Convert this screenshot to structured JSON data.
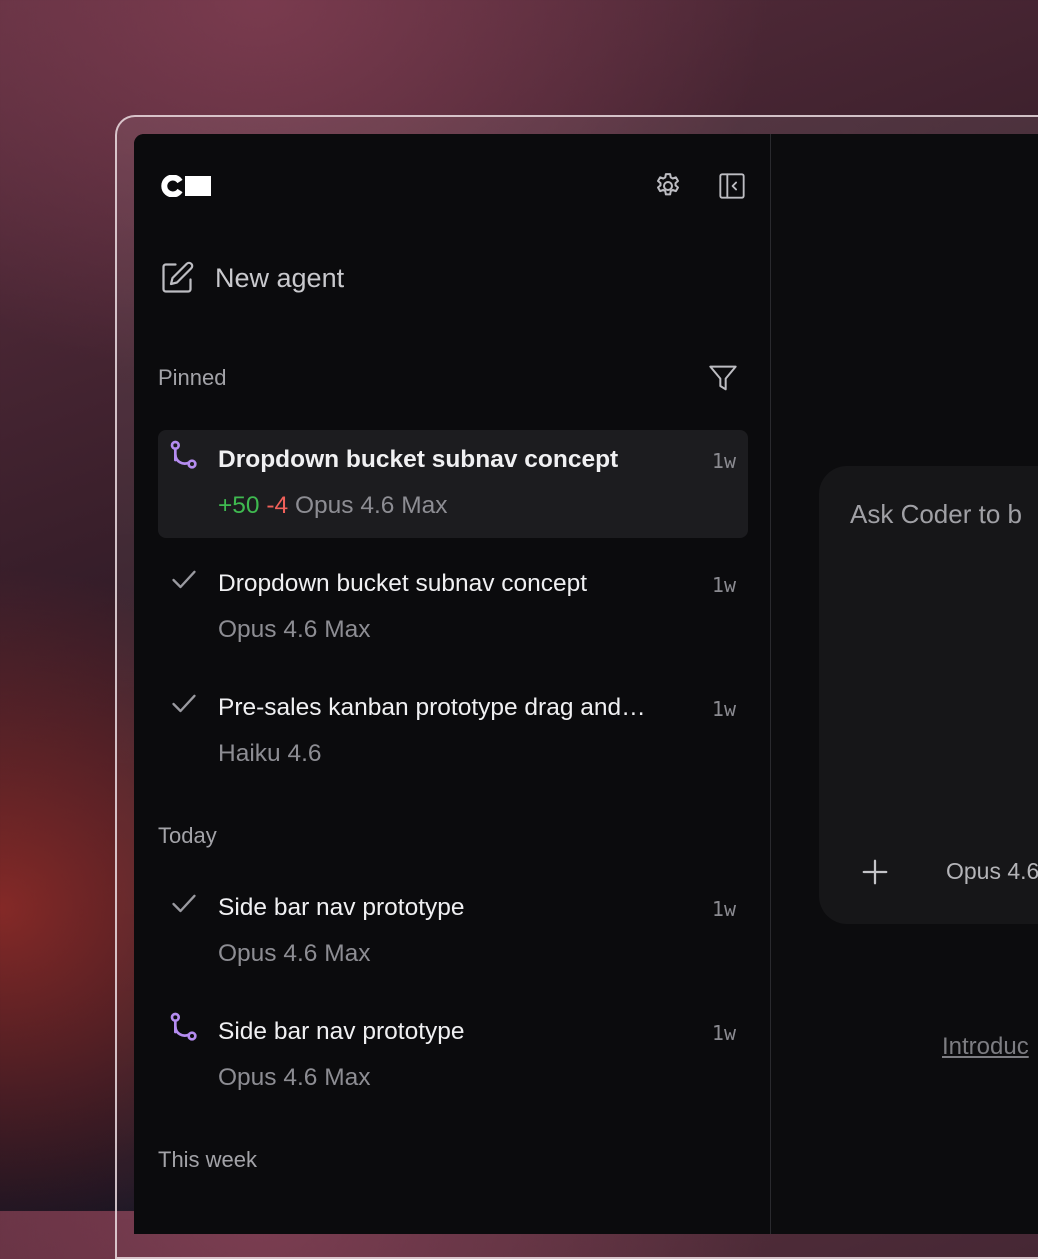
{
  "logo": "C",
  "sidebar": {
    "new_agent_label": "New agent",
    "sections": {
      "pinned": "Pinned",
      "today": "Today",
      "this_week": "This week"
    },
    "pinned_items": [
      {
        "status": "branch",
        "title": "Dropdown bucket subnav concept",
        "time": "1w",
        "additions": "+50",
        "deletions": "-4",
        "model": "Opus 4.6 Max",
        "active": true
      },
      {
        "status": "check",
        "title": "Dropdown bucket subnav concept",
        "time": "1w",
        "model": "Opus 4.6 Max"
      },
      {
        "status": "check",
        "title": "Pre-sales kanban prototype drag and…",
        "time": "1w",
        "model": "Haiku 4.6"
      }
    ],
    "today_items": [
      {
        "status": "check",
        "title": "Side bar nav prototype",
        "time": "1w",
        "model": "Opus 4.6 Max"
      },
      {
        "status": "branch",
        "title": "Side bar nav prototype",
        "time": "1w",
        "model": "Opus 4.6 Max"
      }
    ]
  },
  "main": {
    "prompt_placeholder": "Ask Coder to b",
    "model_selector": "Opus 4.6",
    "intro_link": "Introduc"
  },
  "colors": {
    "accent_purple": "#b58cf0",
    "additions_green": "#3fb950",
    "deletions_red": "#f0605a"
  }
}
